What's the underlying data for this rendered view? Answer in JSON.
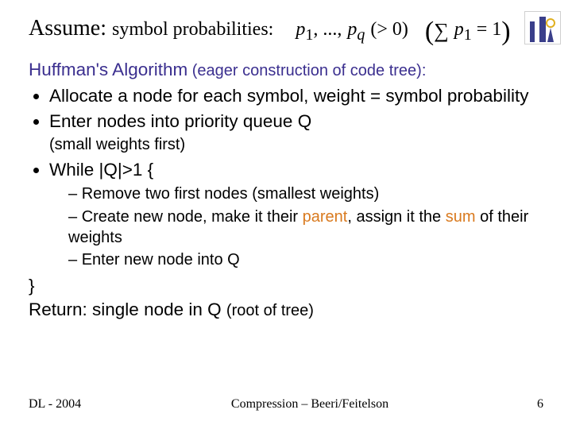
{
  "header": {
    "assume_prefix": "Assume:",
    "assume_text_after": "symbol probabilities:"
  },
  "math": {
    "p1": "p",
    "sub1": "1",
    "ellipsis": ", ...,",
    "pq": "p",
    "subq": "q",
    "gt0": "(> 0)",
    "sum_expr": "p",
    "sum_sub": "1",
    "sum_eq": " = 1"
  },
  "heading": {
    "main": "Huffman's  Algorithm",
    "sub": " (eager construction of code tree):"
  },
  "bullets": {
    "b1": "Allocate a node for each symbol, weight = symbol probability",
    "b2": "Enter nodes into priority queue Q",
    "note": "(small weights first)",
    "b3": "While |Q|>1 {",
    "inner1": "Remove two first nodes (smallest weights)",
    "inner2_a": "Create new node, make it their ",
    "inner2_parent": "parent",
    "inner2_b": ", assign it the ",
    "inner2_sum": "sum",
    "inner2_c": " of their weights",
    "inner3": "Enter new node into Q"
  },
  "closing": {
    "brace": "}",
    "ret_a": "Return: single node in Q ",
    "ret_sub": "(root of tree)"
  },
  "footer": {
    "left": "DL - 2004",
    "center": "Compression – Beeri/Feitelson",
    "page": "6"
  },
  "logo": {
    "name": "institution-logo"
  }
}
